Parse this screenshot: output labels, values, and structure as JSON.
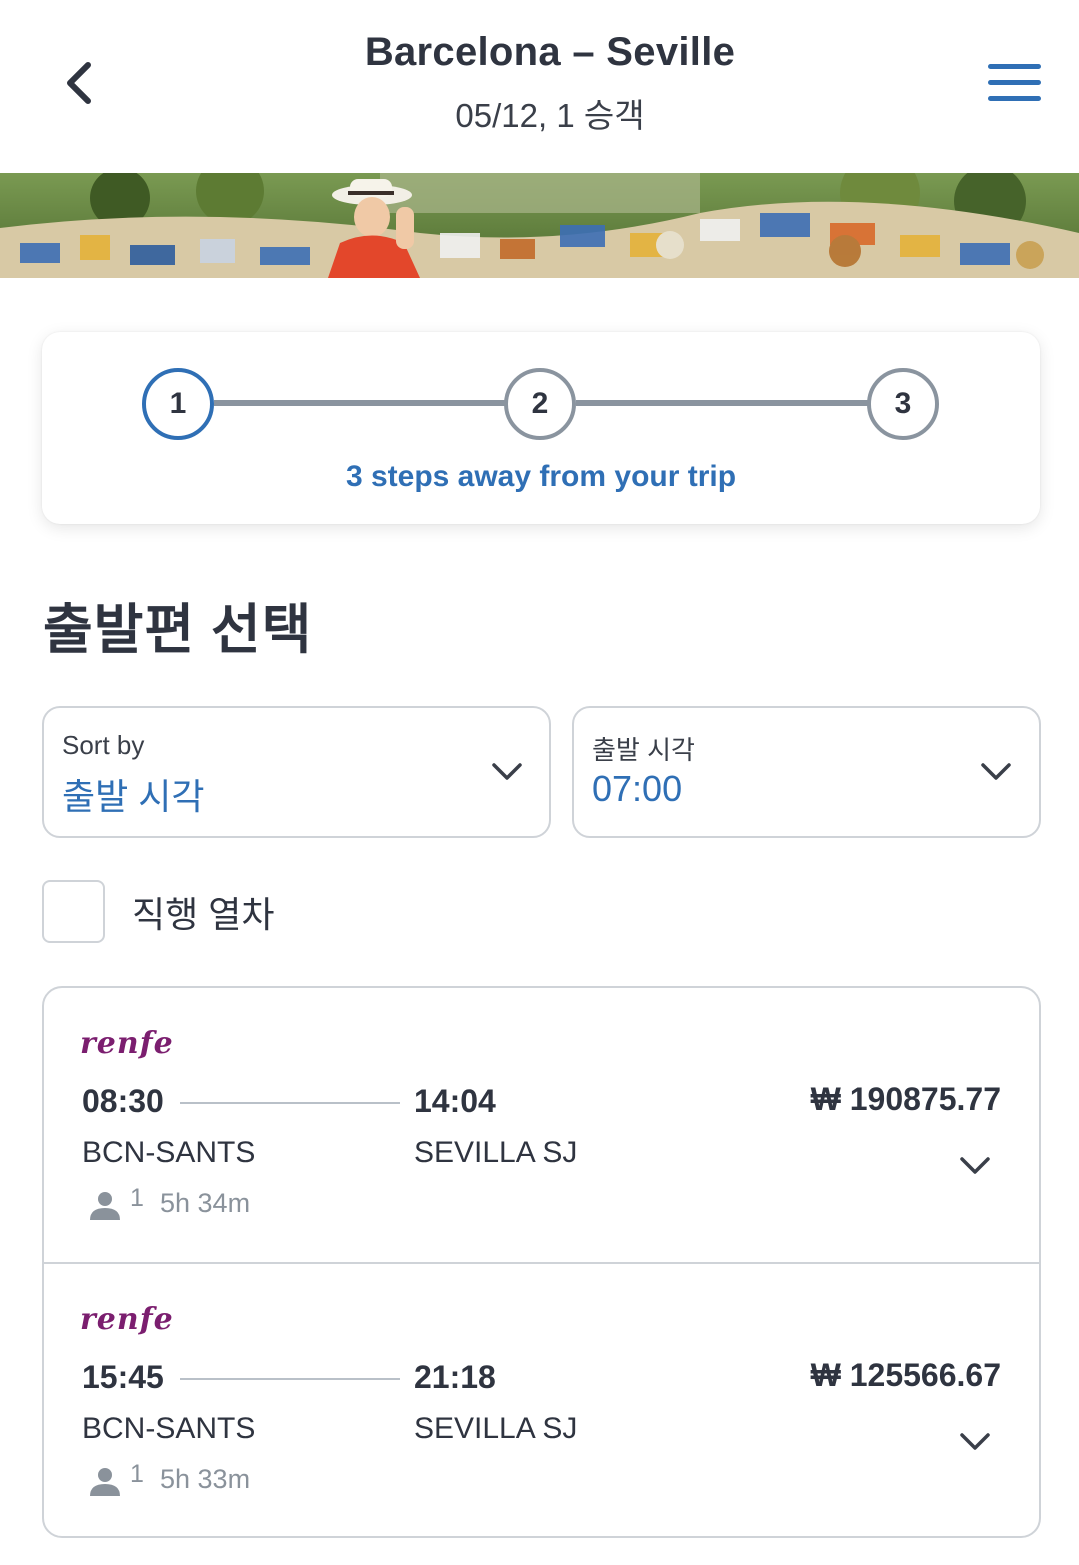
{
  "header": {
    "title": "Barcelona – Seville",
    "subtitle": "05/12, 1 승객"
  },
  "steps": {
    "items": [
      "1",
      "2",
      "3"
    ],
    "active_index": 0,
    "caption": "3 steps away from your trip"
  },
  "section_title": "출발편 선택",
  "filters": {
    "sort": {
      "label": "Sort by",
      "value": "출발 시각"
    },
    "departure_time": {
      "label": "출발 시각",
      "value": "07:00"
    }
  },
  "direct_only": {
    "label": "직행 열차",
    "checked": false
  },
  "colors": {
    "accent": "#2f6fb5",
    "brand_renfe": "#7b1e6f",
    "text": "#2f3440",
    "muted": "#8a929b",
    "border": "#cfd3d8"
  },
  "results": [
    {
      "operator": "renfe",
      "departure_time": "08:30",
      "arrival_time": "14:04",
      "departure_station": "BCN-SANTS",
      "arrival_station": "SEVILLA SJ",
      "price": "₩ 190875.77",
      "passengers": "1",
      "duration": "5h 34m"
    },
    {
      "operator": "renfe",
      "departure_time": "15:45",
      "arrival_time": "21:18",
      "departure_station": "BCN-SANTS",
      "arrival_station": "SEVILLA SJ",
      "price": "₩ 125566.67",
      "passengers": "1",
      "duration": "5h 33m"
    }
  ],
  "icons": {
    "back": "chevron-left-icon",
    "menu": "hamburger-menu-icon",
    "dropdown": "chevron-down-icon",
    "passenger": "person-icon",
    "expand": "chevron-down-icon"
  }
}
